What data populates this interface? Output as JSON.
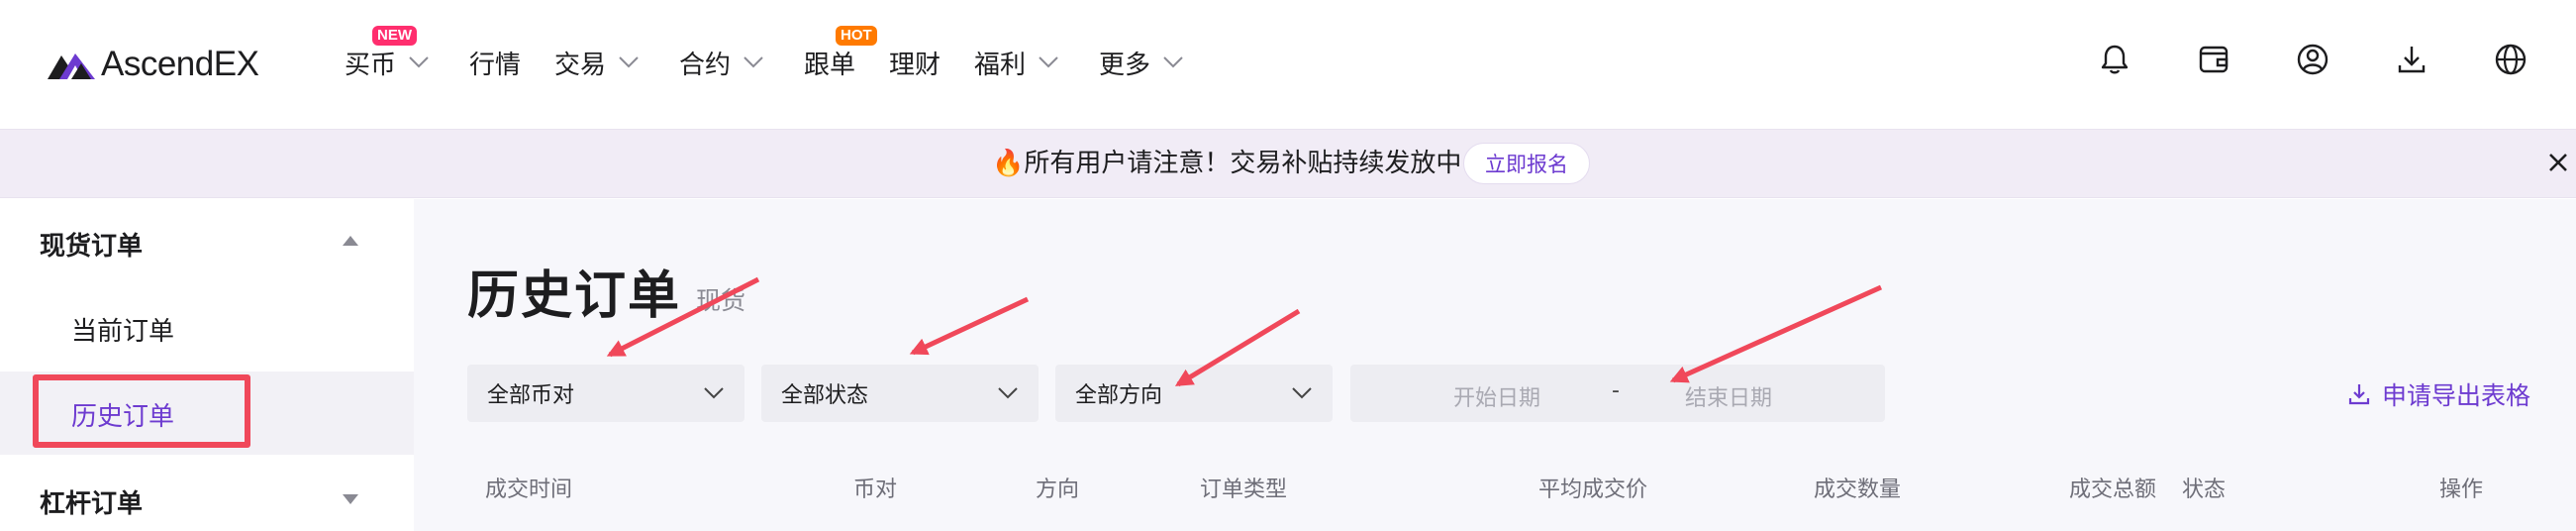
{
  "brand": {
    "name": "AscendEX",
    "accent": "#6d3bd0"
  },
  "nav": {
    "items": [
      {
        "label": "买币",
        "has_menu": true,
        "badge": "NEW"
      },
      {
        "label": "行情",
        "has_menu": false
      },
      {
        "label": "交易",
        "has_menu": true
      },
      {
        "label": "合约",
        "has_menu": true
      },
      {
        "label": "跟单",
        "has_menu": false,
        "badge": "HOT"
      },
      {
        "label": "理财",
        "has_menu": false
      },
      {
        "label": "福利",
        "has_menu": true
      },
      {
        "label": "更多",
        "has_menu": true
      }
    ],
    "icons": [
      "bell-icon",
      "wallet-icon",
      "user-icon",
      "download-icon",
      "globe-icon"
    ]
  },
  "banner": {
    "text": "🔥所有用户请注意！交易补贴持续发放中",
    "button": "立即报名"
  },
  "sidebar": {
    "groups": [
      {
        "label": "现货订单",
        "expanded": true,
        "items": [
          "当前订单",
          "历史订单"
        ],
        "active": "历史订单"
      },
      {
        "label": "杠杆订单",
        "expanded": false
      }
    ]
  },
  "main": {
    "title": "历史订单",
    "subtitle": "现货",
    "filters": {
      "pair": "全部币对",
      "status": "全部状态",
      "direction": "全部方向",
      "start_date_placeholder": "开始日期",
      "date_separator": "-",
      "end_date_placeholder": "结束日期"
    },
    "export": "申请导出表格",
    "columns": [
      "成交时间",
      "币对",
      "方向",
      "订单类型",
      "平均成交价",
      "成交数量",
      "成交总额",
      "状态",
      "操作"
    ]
  },
  "colors": {
    "annotation_red": "#f0485a",
    "banner_bg": "#f1ecf6",
    "main_bg": "#f7f7fb",
    "new_badge": "#ff2e6e",
    "hot_badge": "#ff7a00"
  }
}
